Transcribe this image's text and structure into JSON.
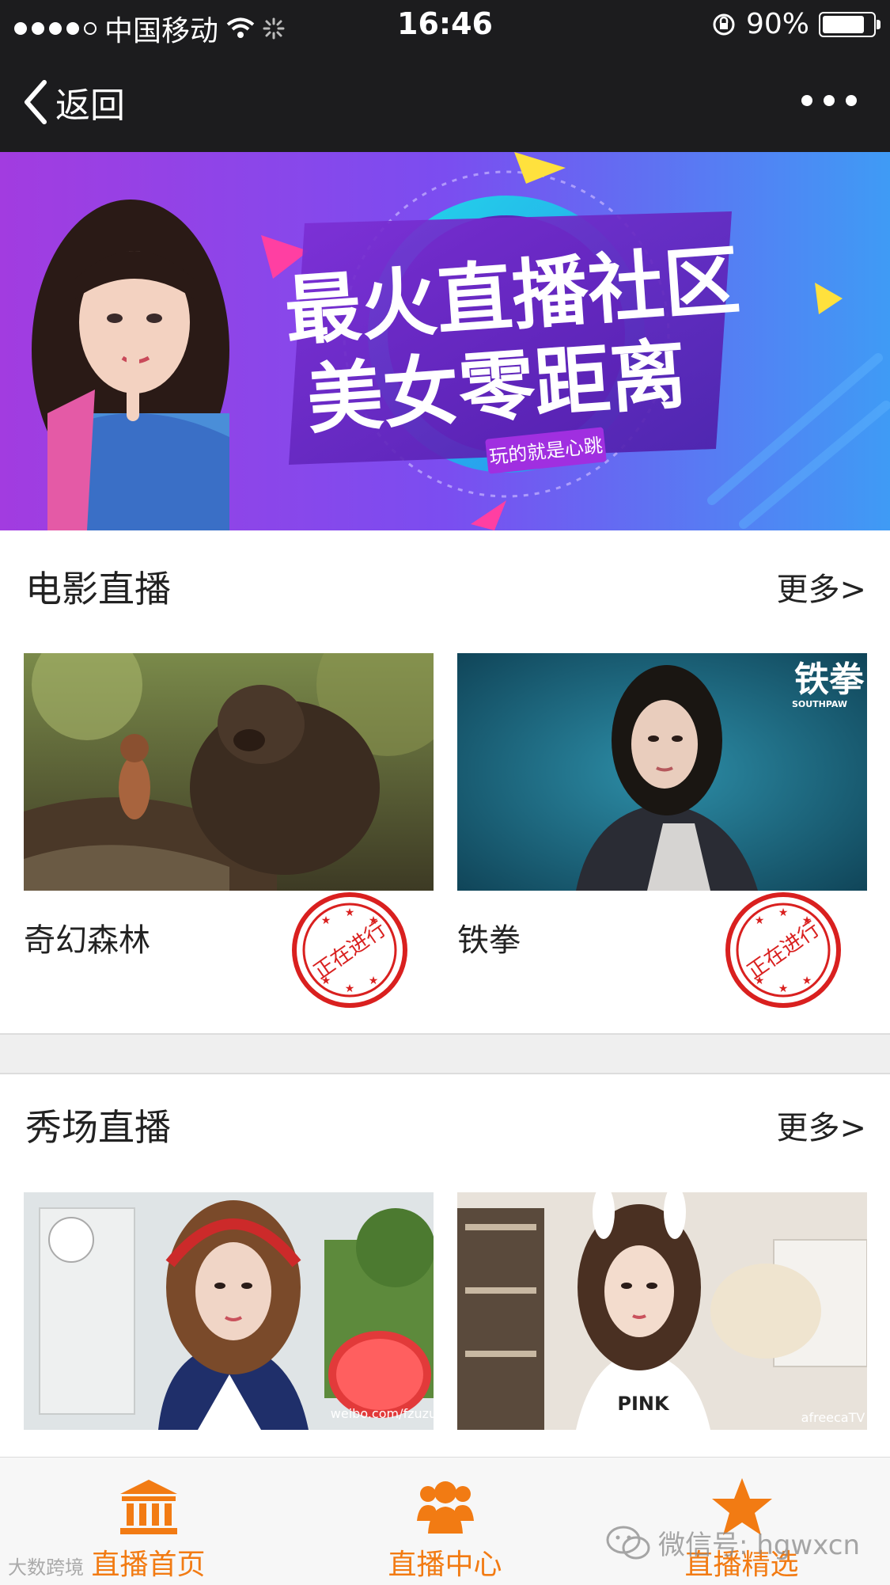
{
  "status_bar": {
    "carrier": "中国移动",
    "time": "16:46",
    "battery": "90%",
    "battery_level": 0.9
  },
  "nav": {
    "back_label": "返回"
  },
  "banner": {
    "line1": "最火直播社区",
    "line2": "美女零距离",
    "tag": "玩的就是心跳"
  },
  "sections": [
    {
      "title": "电影直播",
      "more": "更多>",
      "items": [
        {
          "name": "奇幻森林",
          "stamp": "正在进行"
        },
        {
          "name": "铁拳",
          "stamp": "正在进行",
          "poster_text": "铁拳",
          "poster_sub": "SOUTHPAW"
        }
      ]
    },
    {
      "title": "秀场直播",
      "more": "更多>",
      "items": [
        {
          "name": "",
          "overlay": "weibo.com/fzuzu"
        },
        {
          "name": "",
          "overlay": "afreecaTV"
        }
      ]
    }
  ],
  "tabbar": {
    "tabs": [
      {
        "label": "直播首页",
        "icon": "bank-icon"
      },
      {
        "label": "直播中心",
        "icon": "group-icon"
      },
      {
        "label": "直播精选",
        "icon": "star-icon"
      }
    ]
  },
  "watermark": {
    "text": "微信号: hgwxcn",
    "corner": "大数跨境"
  },
  "colors": {
    "accent": "#f27b13",
    "stamp": "#d9201f",
    "bar": "#1c1c1e"
  }
}
